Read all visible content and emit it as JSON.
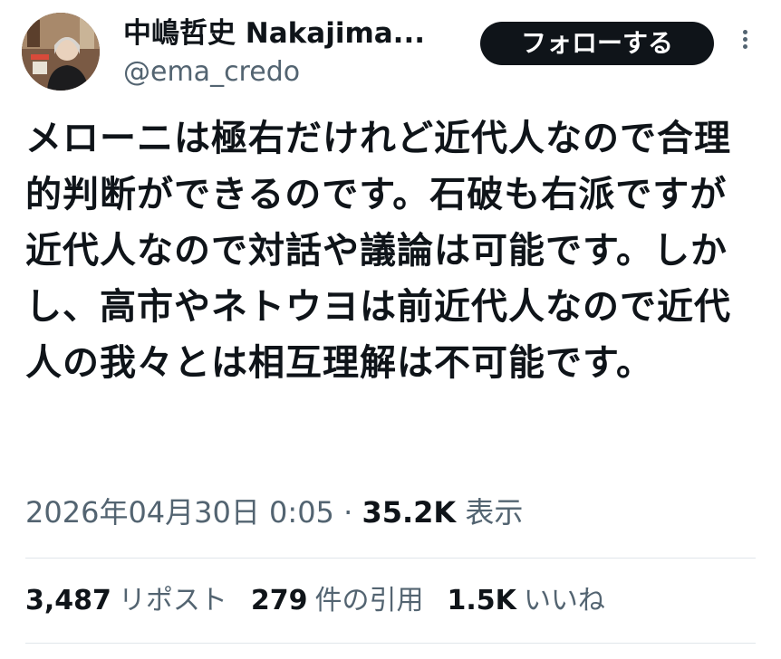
{
  "author": {
    "display_name": "中嶋哲史 Nakajima...",
    "handle": "@ema_credo",
    "avatar": "profile-photo"
  },
  "header": {
    "follow_label": "フォローする",
    "more_icon": "more-vertical-icon"
  },
  "tweet": {
    "text": "メローニは極右だけれど近代人なので合理的判断ができるのです。石破も右派ですが近代人なので対話や議論は可能です。しかし、高市やネトウヨは前近代人なので近代人の我々とは相互理解は不可能です。"
  },
  "meta": {
    "timestamp": "2026年04月30日 0:05",
    "separator": "·",
    "views_count": "35.2K",
    "views_label": "表示"
  },
  "stats": {
    "reposts_count": "3,487",
    "reposts_label": "リポスト",
    "quotes_count": "279",
    "quotes_label": "件の引用",
    "likes_count": "1.5K",
    "likes_label": "いいね"
  },
  "colors": {
    "text_primary": "#0f1419",
    "text_secondary": "#536471",
    "button_bg": "#0f1419",
    "button_text": "#ffffff",
    "divider": "#e1e6ea"
  }
}
